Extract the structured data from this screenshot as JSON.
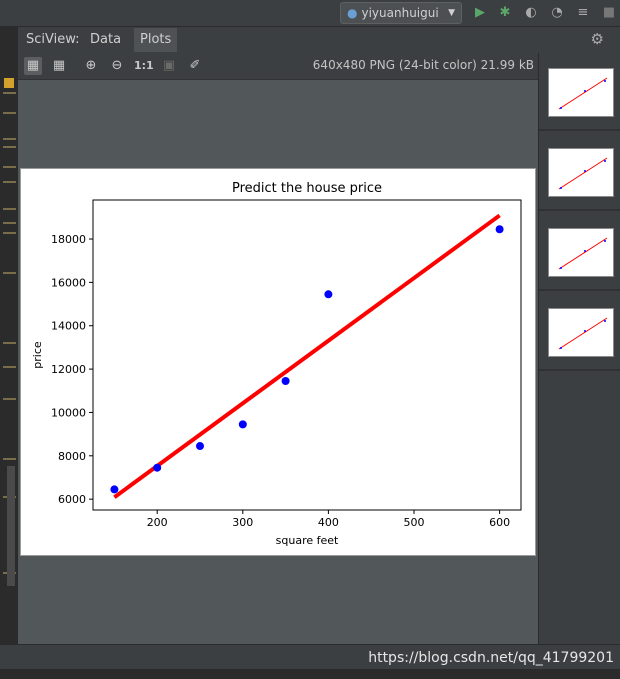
{
  "topbar": {
    "user": "yiyuanhuigui"
  },
  "sciview": {
    "tabs": [
      {
        "label": "SciView:",
        "active": false
      },
      {
        "label": "Data",
        "active": false
      },
      {
        "label": "Plots",
        "active": true
      }
    ]
  },
  "toolbar": {
    "actual_size_label": "1:1",
    "image_info": "640x480 PNG (24-bit color) 21.99 kB"
  },
  "watermark": "https://blog.csdn.net/qq_41799201",
  "colors": {
    "points": "#0000ff",
    "fit_line": "#ff0000",
    "accent": "#d4a22c"
  },
  "chart_data": {
    "type": "scatter",
    "title": "Predict the house price",
    "xlabel": "square feet",
    "ylabel": "price",
    "xlim": [
      125,
      625
    ],
    "ylim": [
      5500,
      19800
    ],
    "xticks": [
      200,
      300,
      400,
      500,
      600
    ],
    "yticks": [
      6000,
      8000,
      10000,
      12000,
      14000,
      16000,
      18000
    ],
    "grid": false,
    "series": [
      {
        "kind": "points",
        "x": [
          150,
          200,
          250,
          300,
          350,
          400,
          600
        ],
        "y": [
          6450,
          7450,
          8450,
          9450,
          11450,
          15450,
          18450
        ]
      },
      {
        "kind": "line",
        "x": [
          150,
          600
        ],
        "y": [
          6088,
          19088
        ]
      }
    ]
  }
}
